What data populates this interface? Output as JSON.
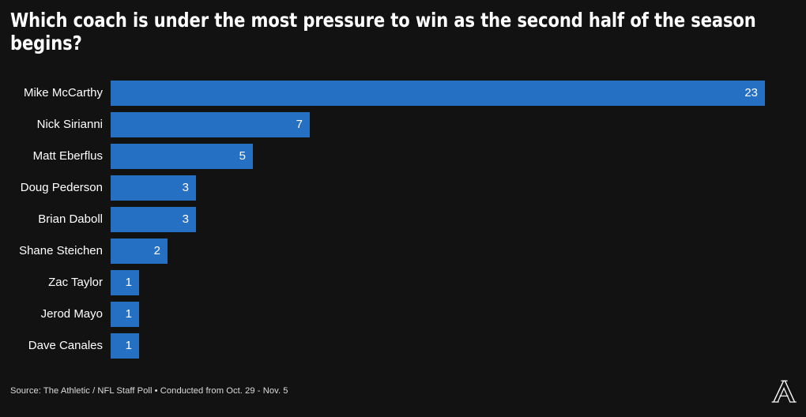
{
  "title": "Which coach is under the most pressure to win as the second half of the season begins?",
  "footnote": "Source: The Athletic / NFL Staff Poll • Conducted from Oct. 29 - Nov. 5",
  "brand": {
    "logo_icon": "the-athletic-a-logo",
    "logo_letter": "A"
  },
  "colors": {
    "background": "#121212",
    "bar": "#2670c4",
    "text": "#ffffff",
    "footnote_text": "#dcdcdc"
  },
  "chart_data": {
    "type": "bar",
    "orientation": "horizontal",
    "title": "Which coach is under the most pressure to win as the second half of the season begins?",
    "xlabel": "",
    "ylabel": "",
    "grid": false,
    "legend": null,
    "xlim": [
      0,
      23
    ],
    "value_labels": true,
    "categories": [
      "Mike McCarthy",
      "Nick Sirianni",
      "Matt Eberflus",
      "Doug Pederson",
      "Brian Daboll",
      "Shane Steichen",
      "Zac Taylor",
      "Jerod Mayo",
      "Dave Canales"
    ],
    "values": [
      23,
      7,
      5,
      3,
      3,
      2,
      1,
      1,
      1
    ],
    "series": [
      {
        "name": "Votes",
        "values": [
          23,
          7,
          5,
          3,
          3,
          2,
          1,
          1,
          1
        ]
      }
    ],
    "rows": [
      {
        "label": "Mike McCarthy",
        "value": 23,
        "value_text": "23"
      },
      {
        "label": "Nick Sirianni",
        "value": 7,
        "value_text": "7"
      },
      {
        "label": "Matt Eberflus",
        "value": 5,
        "value_text": "5"
      },
      {
        "label": "Doug Pederson",
        "value": 3,
        "value_text": "3"
      },
      {
        "label": "Brian Daboll",
        "value": 3,
        "value_text": "3"
      },
      {
        "label": "Shane Steichen",
        "value": 2,
        "value_text": "2"
      },
      {
        "label": "Zac Taylor",
        "value": 1,
        "value_text": "1"
      },
      {
        "label": "Jerod Mayo",
        "value": 1,
        "value_text": "1"
      },
      {
        "label": "Dave Canales",
        "value": 1,
        "value_text": "1"
      }
    ]
  }
}
